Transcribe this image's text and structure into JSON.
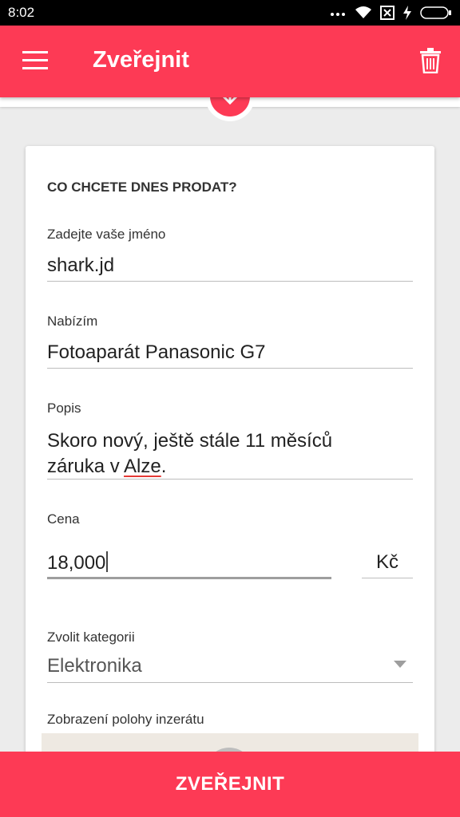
{
  "status": {
    "time": "8:02"
  },
  "appbar": {
    "title": "Zveřejnit"
  },
  "form": {
    "heading": "CO CHCETE DNES PRODAT?",
    "name_label": "Zadejte vaše jméno",
    "name_value": "shark.jd",
    "offer_label": "Nabízím",
    "offer_value": "Fotoaparát Panasonic G7",
    "desc_label": "Popis",
    "desc_value_part1": "Skoro nový, ještě stále 11 měsíců",
    "desc_value_part2_prefix": "záruka v ",
    "desc_value_misspelled": "Alze",
    "desc_value_part2_suffix": ".",
    "price_label": "Cena",
    "price_value": "18,000",
    "currency": "Kč",
    "category_label": "Zvolit kategorii",
    "category_value": "Elektronika",
    "location_label": "Zobrazení polohy inzerátu"
  },
  "footer": {
    "publish_label": "ZVEŘEJNIT"
  },
  "colors": {
    "accent": "#fd3a55"
  }
}
